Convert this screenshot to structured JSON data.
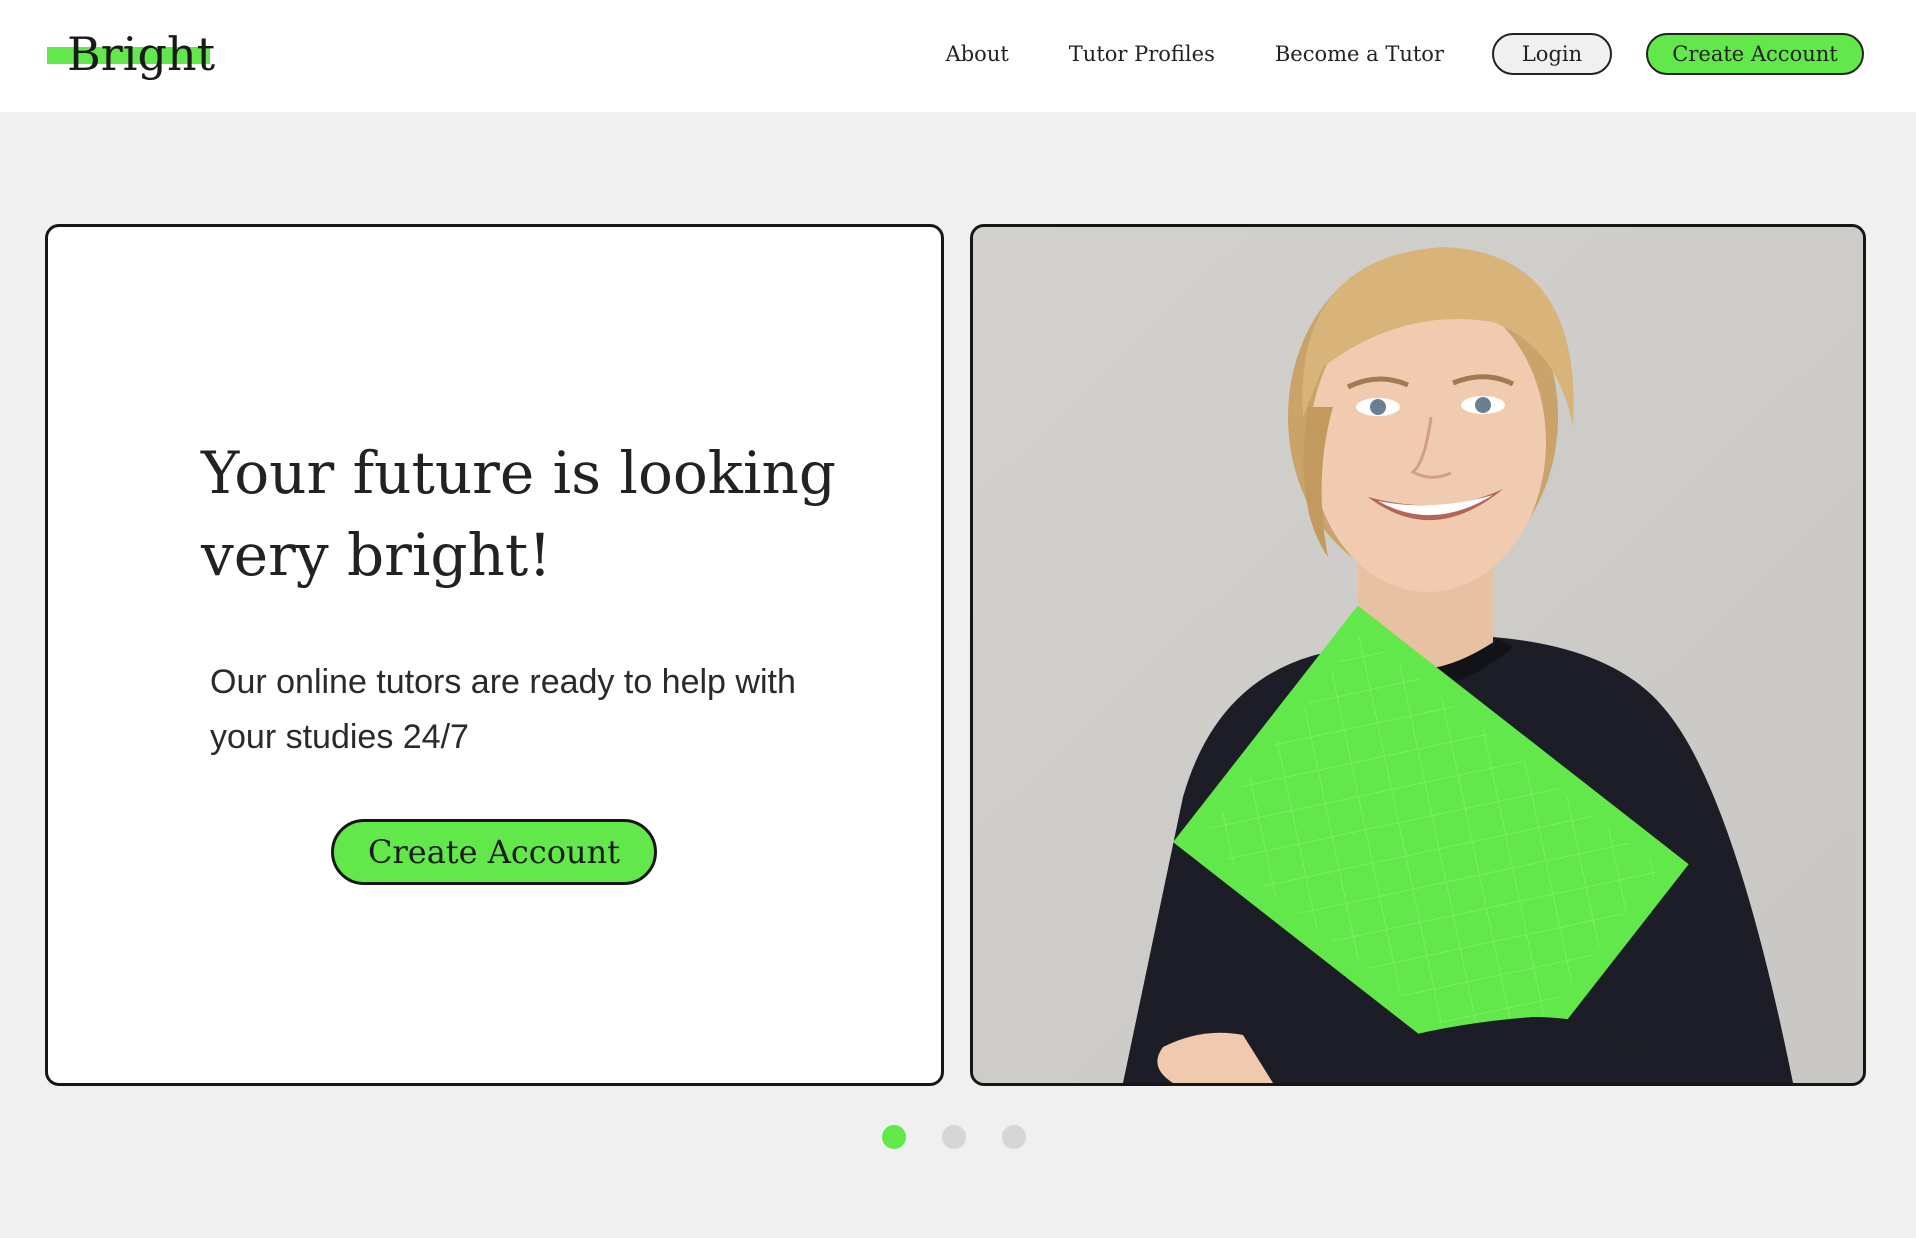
{
  "brand": {
    "logo_text": "Bright",
    "accent_color": "#62e84a"
  },
  "nav": {
    "links": [
      {
        "label": "About"
      },
      {
        "label": "Tutor Profiles"
      },
      {
        "label": "Become a Tutor"
      }
    ],
    "login_label": "Login",
    "create_account_label": "Create Account"
  },
  "hero": {
    "headline": "Your future is looking very bright!",
    "subtext": "Our online tutors are ready to help with your studies 24/7",
    "cta_label": "Create Account",
    "image_icon": "smiling-woman-holding-green-folder-photo"
  },
  "carousel": {
    "slide_count": 3,
    "active_index": 0
  }
}
